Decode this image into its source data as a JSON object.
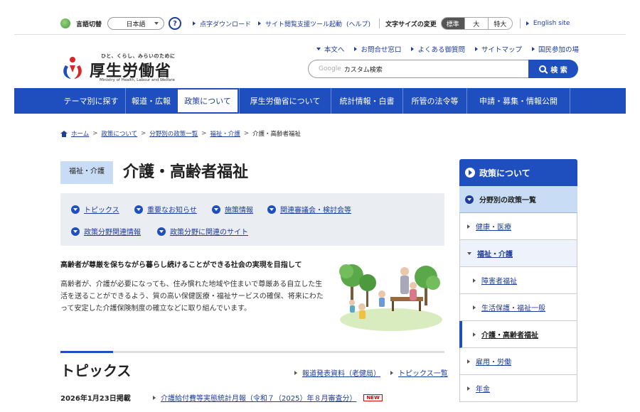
{
  "utility": {
    "lang_label": "言語切替",
    "lang_value": "日本語",
    "help_icon": "?",
    "links": [
      "点字ダウンロード",
      "サイト閲覧支援ツール起動",
      "(ヘルプ)"
    ],
    "font_size_label": "文字サイズの変更",
    "font_sizes": [
      "標準",
      "大",
      "特大"
    ],
    "english_link": "English site"
  },
  "logo": {
    "tagline": "ひと、くらし、みらいのために",
    "name": "厚生労働省",
    "english": "Ministry of Health, Labour and Welfare"
  },
  "header_links": [
    "本文へ",
    "お問合せ窓口",
    "よくある御質問",
    "サイトマップ",
    "国民参加の場"
  ],
  "search": {
    "google": "Google",
    "placeholder": "カスタム検索",
    "button": "検 索"
  },
  "global_nav": [
    "テーマ別に探す",
    "報道・広報",
    "政策について",
    "厚生労働省について",
    "統計情報・白書",
    "所管の法令等",
    "申請・募集・情報公開"
  ],
  "breadcrumb": [
    "ホーム",
    "政策について",
    "分野別の政策一覧",
    "福祉・介護",
    "介護・高齢者福祉"
  ],
  "page": {
    "category": "福祉・介護",
    "title": "介護・高齢者福祉"
  },
  "anchors": [
    "トピックス",
    "重要なお知らせ",
    "施策情報",
    "関連審議会・検討会等",
    "政策分野関連情報",
    "政策分野に関連のサイト"
  ],
  "intro": {
    "lead": "高齢者が尊厳を保ちながら暮らし続けることができる社会の実現を目指して",
    "body": "高齢者が、介護が必要になっても、住み慣れた地域や住まいで尊厳ある自立した生活を送ることができるよう、質の高い保健医療・福祉サービスの確保、将来にわたって安定した介護保険制度の確立などに取り組んでいます。"
  },
  "topics": {
    "title": "トピックス",
    "links": [
      "報道発表資料（老健局）",
      "トピックス一覧"
    ],
    "news_date": "2026年1月23日掲載",
    "news_text": "介護給付費等実態統計月報（令和７（2025）年８月審査分）",
    "new_badge": "NEW"
  },
  "side_nav": {
    "title": "政策について",
    "section": "分野別の政策一覧",
    "items": [
      "健康・医療",
      "福祉・介護",
      "障害者福祉",
      "生活保護・福祉一般",
      "介護・高齢者福祉",
      "雇用・労働",
      "年金"
    ]
  }
}
